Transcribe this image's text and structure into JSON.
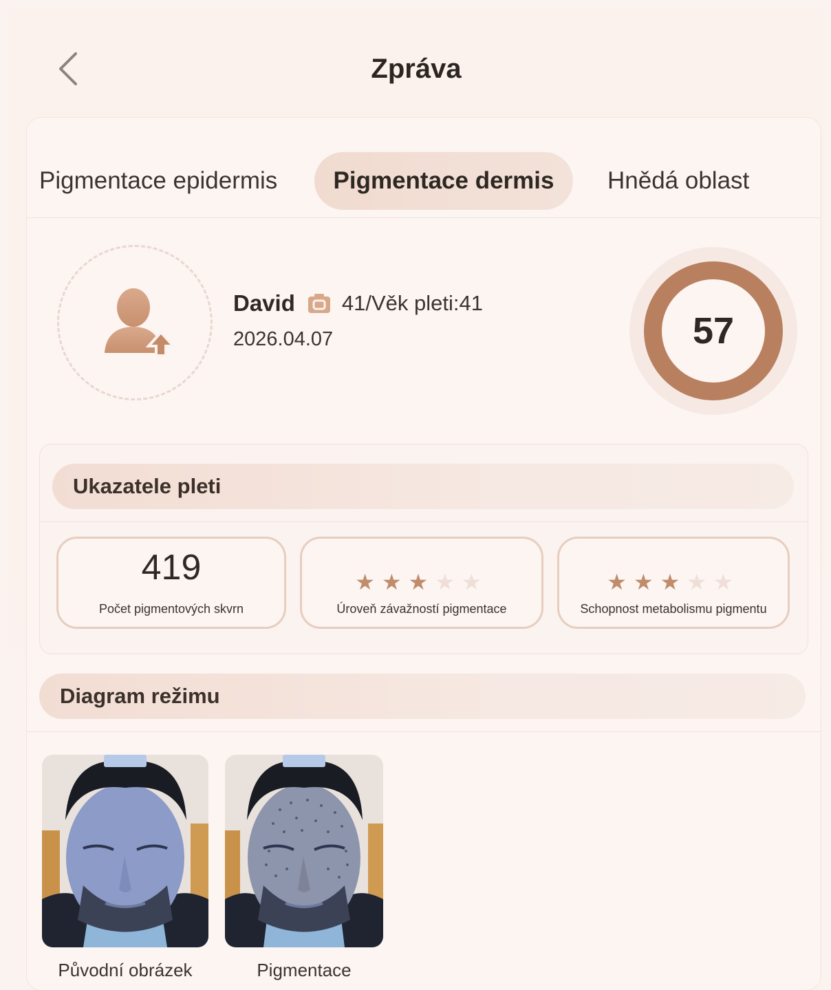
{
  "header": {
    "title": "Zpráva",
    "back_icon": "chevron-left-icon"
  },
  "tabs": [
    {
      "label": "Pigmentace epidermis",
      "active": false
    },
    {
      "label": "Pigmentace dermis",
      "active": true
    },
    {
      "label": "Hnědá oblast",
      "active": false
    }
  ],
  "profile": {
    "name": "David",
    "camera_icon": "camera-icon",
    "age_text": "41/Věk pleti:41",
    "date": "2026.04.07",
    "avatar_icon": "user-upload-icon",
    "score": "57",
    "score_fraction": 0.57
  },
  "indicators": {
    "title": "Ukazatele pleti",
    "items": [
      {
        "value": "419",
        "label": "Počet pigmentových skvrn"
      },
      {
        "stars": 3,
        "max_stars": 5,
        "label": "Úroveň závažností pigmentace"
      },
      {
        "stars": 3,
        "max_stars": 5,
        "label": "Schopnost metabolismu pigmentu"
      }
    ]
  },
  "diagram": {
    "title": "Diagram režimu",
    "images": [
      {
        "label": "Původní obrázek"
      },
      {
        "label": "Pigmentace"
      }
    ]
  },
  "colors": {
    "accent": "#b8805f",
    "star_on": "#c08c6c",
    "star_off": "#efdfd8",
    "background": "#fbf3ef"
  }
}
